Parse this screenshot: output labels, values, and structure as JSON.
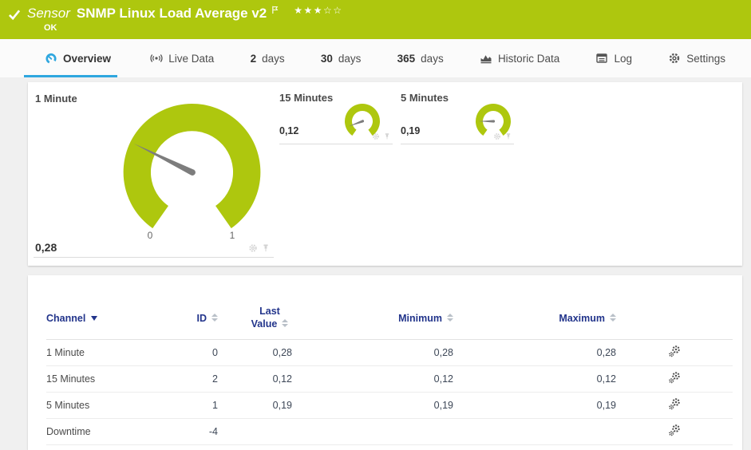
{
  "header": {
    "type_label": "Sensor",
    "title": "SNMP Linux Load Average v2",
    "status": "OK",
    "rating_filled": "★★★",
    "rating_empty": "☆☆"
  },
  "tabs": [
    {
      "label": "Overview",
      "icon": "gauge-icon",
      "active": true
    },
    {
      "label": "Live Data",
      "icon": "broadcast-icon"
    },
    {
      "num": "2",
      "label": "days"
    },
    {
      "num": "30",
      "label": "days"
    },
    {
      "num": "365",
      "label": "days"
    },
    {
      "label": "Historic Data",
      "icon": "chart-icon"
    },
    {
      "label": "Log",
      "icon": "log-icon"
    },
    {
      "label": "Settings",
      "icon": "gear-icon"
    }
  ],
  "gauges": {
    "primary": {
      "title": "1 Minute",
      "value_display": "0,28",
      "value": 0.28,
      "scale_min": "0",
      "scale_max": "1"
    },
    "secondary_1": {
      "title": "15 Minutes",
      "value_display": "0,12",
      "value": 0.12
    },
    "secondary_2": {
      "title": "5 Minutes",
      "value_display": "0,19",
      "value": 0.19
    },
    "gauge_color": "#aec70e",
    "needle_color": "#7d7d7d"
  },
  "table": {
    "headers": {
      "channel": "Channel",
      "id": "ID",
      "last_value": "Last Value",
      "minimum": "Minimum",
      "maximum": "Maximum"
    },
    "rows": [
      {
        "channel": "1 Minute",
        "id": "0",
        "last_value": "0,28",
        "minimum": "0,28",
        "maximum": "0,28"
      },
      {
        "channel": "15 Minutes",
        "id": "2",
        "last_value": "0,12",
        "minimum": "0,12",
        "maximum": "0,12"
      },
      {
        "channel": "5 Minutes",
        "id": "1",
        "last_value": "0,19",
        "minimum": "0,19",
        "maximum": "0,19"
      },
      {
        "channel": "Downtime",
        "id": "-4",
        "last_value": "",
        "minimum": "",
        "maximum": ""
      }
    ]
  },
  "colors": {
    "header_green": "#aec70e",
    "accent_blue": "#2fa7df",
    "table_header_navy": "#22348b"
  }
}
